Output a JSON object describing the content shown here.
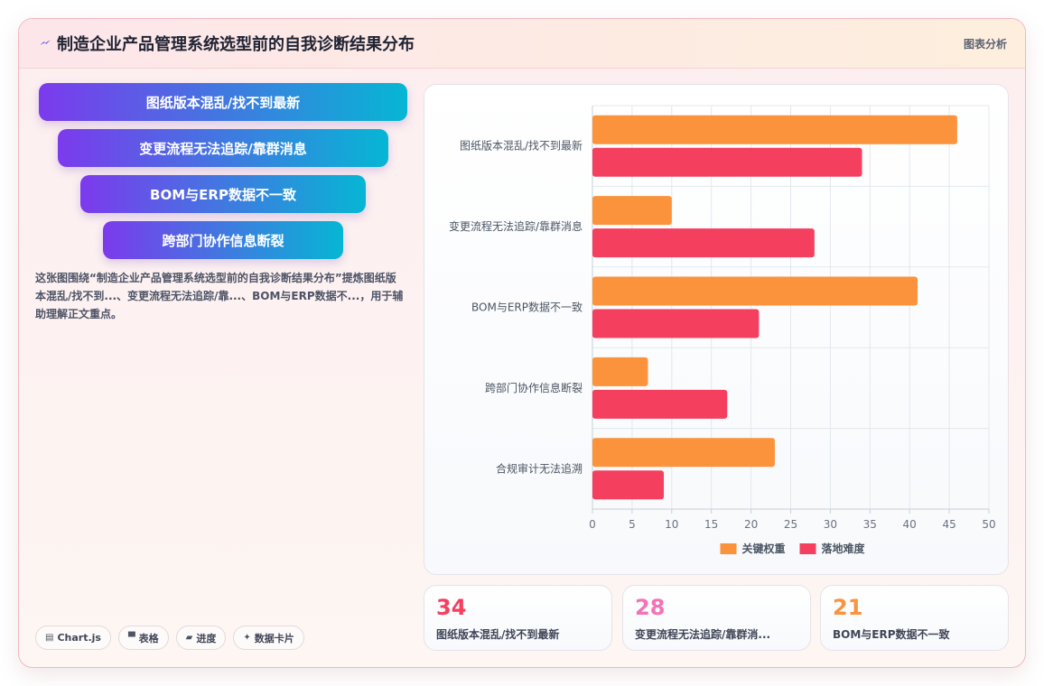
{
  "header": {
    "title": "制造企业产品管理系统选型前的自我诊断结果分布",
    "tag": "图表分析",
    "logo_icon": "lightning-icon"
  },
  "funnel": {
    "steps": [
      "图纸版本混乱/找不到最新",
      "变更流程无法追踪/靠群消息",
      "BOM与ERP数据不一致",
      "跨部门协作信息断裂"
    ]
  },
  "description": "这张图围绕“制造企业产品管理系统选型前的自我诊断结果分布”提炼图纸版本混乱/找不到...、变更流程无法追踪/靠...、BOM与ERP数据不...，用于辅助理解正文重点。",
  "chips": [
    {
      "icon": "chart-icon",
      "glyph": "▤",
      "label": "Chart.js"
    },
    {
      "icon": "table-icon",
      "glyph": "▀",
      "label": "表格"
    },
    {
      "icon": "folder-icon",
      "glyph": "▰",
      "label": "进度"
    },
    {
      "icon": "sparkle-icon",
      "glyph": "✦",
      "label": "数据卡片"
    }
  ],
  "kpis": [
    {
      "value": "34",
      "label": "图纸版本混乱/找不到最新",
      "color": "#f43f5e"
    },
    {
      "value": "28",
      "label": "变更流程无法追踪/靠群消...",
      "color": "#f472b6"
    },
    {
      "value": "21",
      "label": "BOM与ERP数据不一致",
      "color": "#fb923c"
    }
  ],
  "chart_data": {
    "type": "bar",
    "orientation": "horizontal",
    "categories": [
      "图纸版本混乱/找不到最新",
      "变更流程无法追踪/靠群消息",
      "BOM与ERP数据不一致",
      "跨部门协作信息断裂",
      "合规审计无法追溯"
    ],
    "series": [
      {
        "name": "关键权重",
        "values": [
          46,
          10,
          41,
          7,
          23
        ],
        "color": "#fb923c"
      },
      {
        "name": "落地难度",
        "values": [
          34,
          28,
          21,
          17,
          9
        ],
        "color": "#f43f5e"
      }
    ],
    "xlim": [
      0,
      50
    ],
    "xticks": [
      0,
      5,
      10,
      15,
      20,
      25,
      30,
      35,
      40,
      45,
      50
    ],
    "grid": true,
    "legend": "bottom"
  }
}
